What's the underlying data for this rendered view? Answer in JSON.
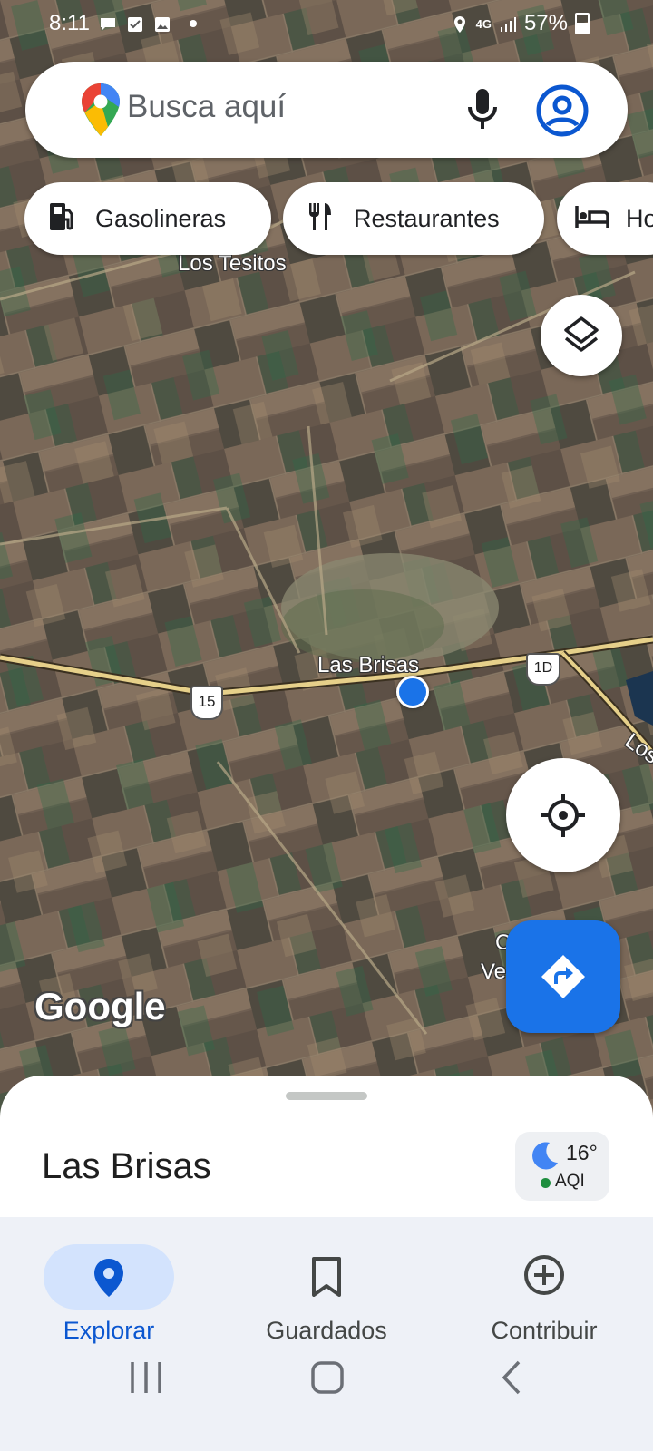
{
  "status_bar": {
    "time": "8:11",
    "network": "4G",
    "battery": "57%"
  },
  "search": {
    "placeholder": "Busca aquí",
    "icons": [
      "maps-logo-icon",
      "microphone-icon",
      "account-icon"
    ]
  },
  "chips": [
    {
      "label": "Gasolineras",
      "icon": "gas-station-icon"
    },
    {
      "label": "Restaurantes",
      "icon": "restaurant-icon"
    },
    {
      "label": "Ho",
      "icon": "hotel-icon"
    }
  ],
  "map": {
    "labels": [
      "Los Tesitos",
      "Las Brisas",
      "Los",
      "C",
      "Ve"
    ],
    "road_shields": [
      "15",
      "1D"
    ],
    "watermark": "Google",
    "layer": "satellite"
  },
  "sheet": {
    "title": "Las Brisas",
    "weather_temp": "16°",
    "weather_aqi": "AQI"
  },
  "bottom_nav": [
    {
      "label": "Explorar",
      "icon": "location-pin-icon",
      "active": true
    },
    {
      "label": "Guardados",
      "icon": "bookmark-icon",
      "active": false
    },
    {
      "label": "Contribuir",
      "icon": "add-circle-icon",
      "active": false
    }
  ],
  "colors": {
    "accent": "#1a73e8",
    "active_pill": "#d3e3fd",
    "active_text": "#0b57d0"
  }
}
